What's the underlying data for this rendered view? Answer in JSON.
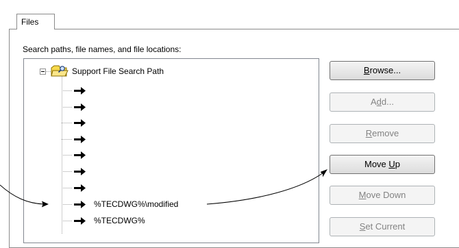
{
  "tabs": [
    {
      "label": "Files"
    }
  ],
  "search_label": "Search paths, file names, and file locations:",
  "tree": {
    "root_label": "Support File Search Path",
    "selected_entry": "%TECDWG%\\modified",
    "last_entry": "%TECDWG%"
  },
  "buttons": {
    "browse": {
      "pre": "",
      "mnemonic": "B",
      "post": "rowse...",
      "enabled": true
    },
    "add": {
      "pre": "A",
      "mnemonic": "d",
      "post": "d...",
      "enabled": false
    },
    "remove": {
      "pre": "",
      "mnemonic": "R",
      "post": "emove",
      "enabled": false
    },
    "move_up": {
      "pre": "Move ",
      "mnemonic": "U",
      "post": "p",
      "enabled": true
    },
    "move_down": {
      "pre": "",
      "mnemonic": "M",
      "post": "ove Down",
      "enabled": false
    },
    "set_current": {
      "pre": "",
      "mnemonic": "S",
      "post": "et Current",
      "enabled": false
    }
  }
}
